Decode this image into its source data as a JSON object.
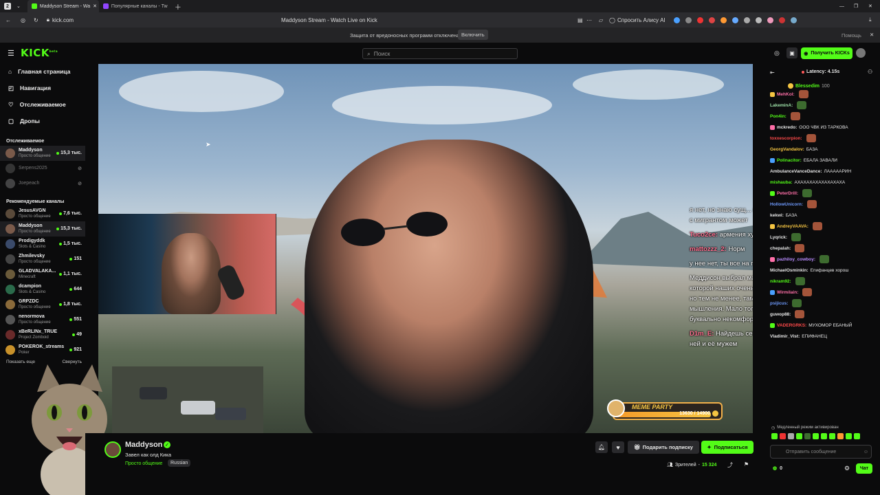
{
  "browser": {
    "tab_count": "2",
    "tabs": [
      {
        "title": "Maddyson Stream - Wa",
        "active": true,
        "color": "#53fc18"
      },
      {
        "title": "Популярные каналы - Tw",
        "active": false,
        "color": "#9146ff"
      }
    ],
    "url": "kick.com",
    "page_title": "Maddyson Stream - Watch Live on Kick",
    "alice_label": "Спросить Алису AI",
    "protection_text": "Защита от вредоносных программ отключена",
    "enable_label": "Включить",
    "help_label": "Помощь"
  },
  "header": {
    "logo": "KICK",
    "logo_sup": "beta",
    "search_placeholder": "Поиск",
    "get_kicks_label": "Получить KICKs",
    "accent_color": "#53fc18"
  },
  "sidebar": {
    "nav": [
      {
        "label": "Главная страница",
        "icon": "home-icon"
      },
      {
        "label": "Навигация",
        "icon": "compass-icon"
      },
      {
        "label": "Отслеживаемое",
        "icon": "heart-icon"
      },
      {
        "label": "Дропы",
        "icon": "gift-icon"
      }
    ],
    "following_title": "Отслеживаемое",
    "following": [
      {
        "name": "Maddyson",
        "category": "Просто общение",
        "viewers": "15,3 тыс.",
        "live": true
      },
      {
        "name": "Serpens2025",
        "category": "",
        "viewers": "",
        "live": false
      },
      {
        "name": "Joepeach",
        "category": "",
        "viewers": "",
        "live": false
      }
    ],
    "recommended_title": "Рекомендуемые каналы",
    "recommended": [
      {
        "name": "JesusAVGN",
        "category": "Просто общение",
        "viewers": "7,6 тыс."
      },
      {
        "name": "Maddyson",
        "category": "Просто общение",
        "viewers": "15,3 тыс."
      },
      {
        "name": "Prodigyddk",
        "category": "Slots & Casino",
        "viewers": "1,5 тыс."
      },
      {
        "name": "Zhmilevsky",
        "category": "Просто общение",
        "viewers": "151"
      },
      {
        "name": "GLADVALAKA...",
        "category": "Minecraft",
        "viewers": "1,1 тыс."
      },
      {
        "name": "dcampion",
        "category": "Slots & Casino",
        "viewers": "644"
      },
      {
        "name": "GRPZDC",
        "category": "Просто общение",
        "viewers": "1,8 тыс."
      },
      {
        "name": "nenormova",
        "category": "Просто общение",
        "viewers": "551"
      },
      {
        "name": "xBeRLINx_TRUE",
        "category": "Project Zomboid",
        "viewers": "49"
      },
      {
        "name": "POKEROK_streams",
        "category": "Poker",
        "viewers": "921"
      }
    ],
    "show_more": "Показать еще",
    "collapse": "Свернуть"
  },
  "video_overlay": {
    "chat": [
      {
        "user": "",
        "text": "я нет, но знаю сущ... правление ждуль, то женщина точно с мигрантом может"
      },
      {
        "user": "Tuco2ce:",
        "text": "армения хуеала"
      },
      {
        "user": "mattozzz_2:",
        "text": "Норм"
      },
      {
        "user": "",
        "text": "у нее нет, ты все на пс 5 потратил"
      },
      {
        "user": "",
        "text": "Меддисон выбрал максимально далекую страну, в которой наших очень мало, хоть по культуре мы близки - но тем не менее, там люди совершенно иного типа мышления. Мало того, что пивозавр, так еще и в буквально некомфортной среде обитания"
      },
      {
        "user": "D1m_E:",
        "text": "Найдешь себе армянку лет 45 и будешь жить с ней и её мужем"
      }
    ],
    "meme_label": "MEME PARTY",
    "meme_progress": "13630 / 14900",
    "meme_fraction": 0.915
  },
  "stream": {
    "name": "Maddyson",
    "title": "Завел как олд Кика",
    "category": "Просто общение",
    "language": "Russian",
    "gift_label": "Подарить подписку",
    "subscribe_label": "Подписаться",
    "viewers_label": "Зрителей",
    "viewers_count": "15 324"
  },
  "chat": {
    "latency": "Latency: 4.15s",
    "pinned_user": "Blessedim",
    "pinned_count": "100",
    "messages": [
      {
        "user": "MehKol:",
        "text": "",
        "color": "#ff6fa8",
        "emote": true
      },
      {
        "user": "LakeminA:",
        "text": "",
        "color": "#9ee2a8",
        "emote": true
      },
      {
        "user": "Pon4in:",
        "text": "",
        "color": "#53fc18",
        "emote": true
      },
      {
        "user": "mckredo:",
        "text": "ООО ЧВК ИЗ ТАРКОВА",
        "color": "#e6e6e6",
        "emote": false
      },
      {
        "user": "toxxescorpion:",
        "text": "",
        "color": "#ff4a4a",
        "emote": true
      },
      {
        "user": "GeorgVandalov:",
        "text": "БАЗА",
        "color": "#f5c542",
        "emote": false
      },
      {
        "user": "Polinacitor:",
        "text": "ЕБАЛА ЗАВАЛИ",
        "color": "#53fc18",
        "emote": false
      },
      {
        "user": "AmbulanceVanceDance:",
        "text": "ЛАААААРИН",
        "color": "#e6e6e6",
        "emote": false
      },
      {
        "user": "mishauba:",
        "text": "АХАХАХАХАХАХАХАХА",
        "color": "#53fc18",
        "emote": false
      },
      {
        "user": "PeterDrill:",
        "text": "",
        "color": "#ff6fa8",
        "emote": true
      },
      {
        "user": "HollowUnicorn:",
        "text": "",
        "color": "#6f9bff",
        "emote": true
      },
      {
        "user": "kekwi:",
        "text": "БАЗА",
        "color": "#e6e6e6",
        "emote": false
      },
      {
        "user": "AndreyVAAVA:",
        "text": "",
        "color": "#f5c542",
        "emote": true
      },
      {
        "user": "Lyqrick:",
        "text": "",
        "color": "#e6e6e6",
        "emote": true
      },
      {
        "user": "chepalah:",
        "text": "",
        "color": "#e6e6e6",
        "emote": true
      },
      {
        "user": "pazhiloy_cowboy:",
        "text": "",
        "color": "#b98cff",
        "emote": true
      },
      {
        "user": "MichaelOsminkin:",
        "text": "Епифанцев хорош",
        "color": "#e6e6e6",
        "emote": false
      },
      {
        "user": "nikram92:",
        "text": "",
        "color": "#53fc18",
        "emote": true
      },
      {
        "user": "Wirmilain:",
        "text": "",
        "color": "#ff6fa8",
        "emote": true
      },
      {
        "user": "psijicus:",
        "text": "",
        "color": "#6f9bff",
        "emote": true
      },
      {
        "user": "guwop88:",
        "text": "",
        "color": "#e6e6e6",
        "emote": true
      },
      {
        "user": "VADERGRKS:",
        "text": "МУХОМОР ЕБАНЫЙ",
        "color": "#ff4a4a",
        "emote": false
      },
      {
        "user": "Vladimir_Vist:",
        "text": "ЕПИФАНЕЦ",
        "color": "#e6e6e6",
        "emote": false
      }
    ],
    "slow_mode": "Медленный режим активирован",
    "input_placeholder": "Отправить сообщение",
    "kicks_count": "0",
    "send_label": "Чат"
  }
}
